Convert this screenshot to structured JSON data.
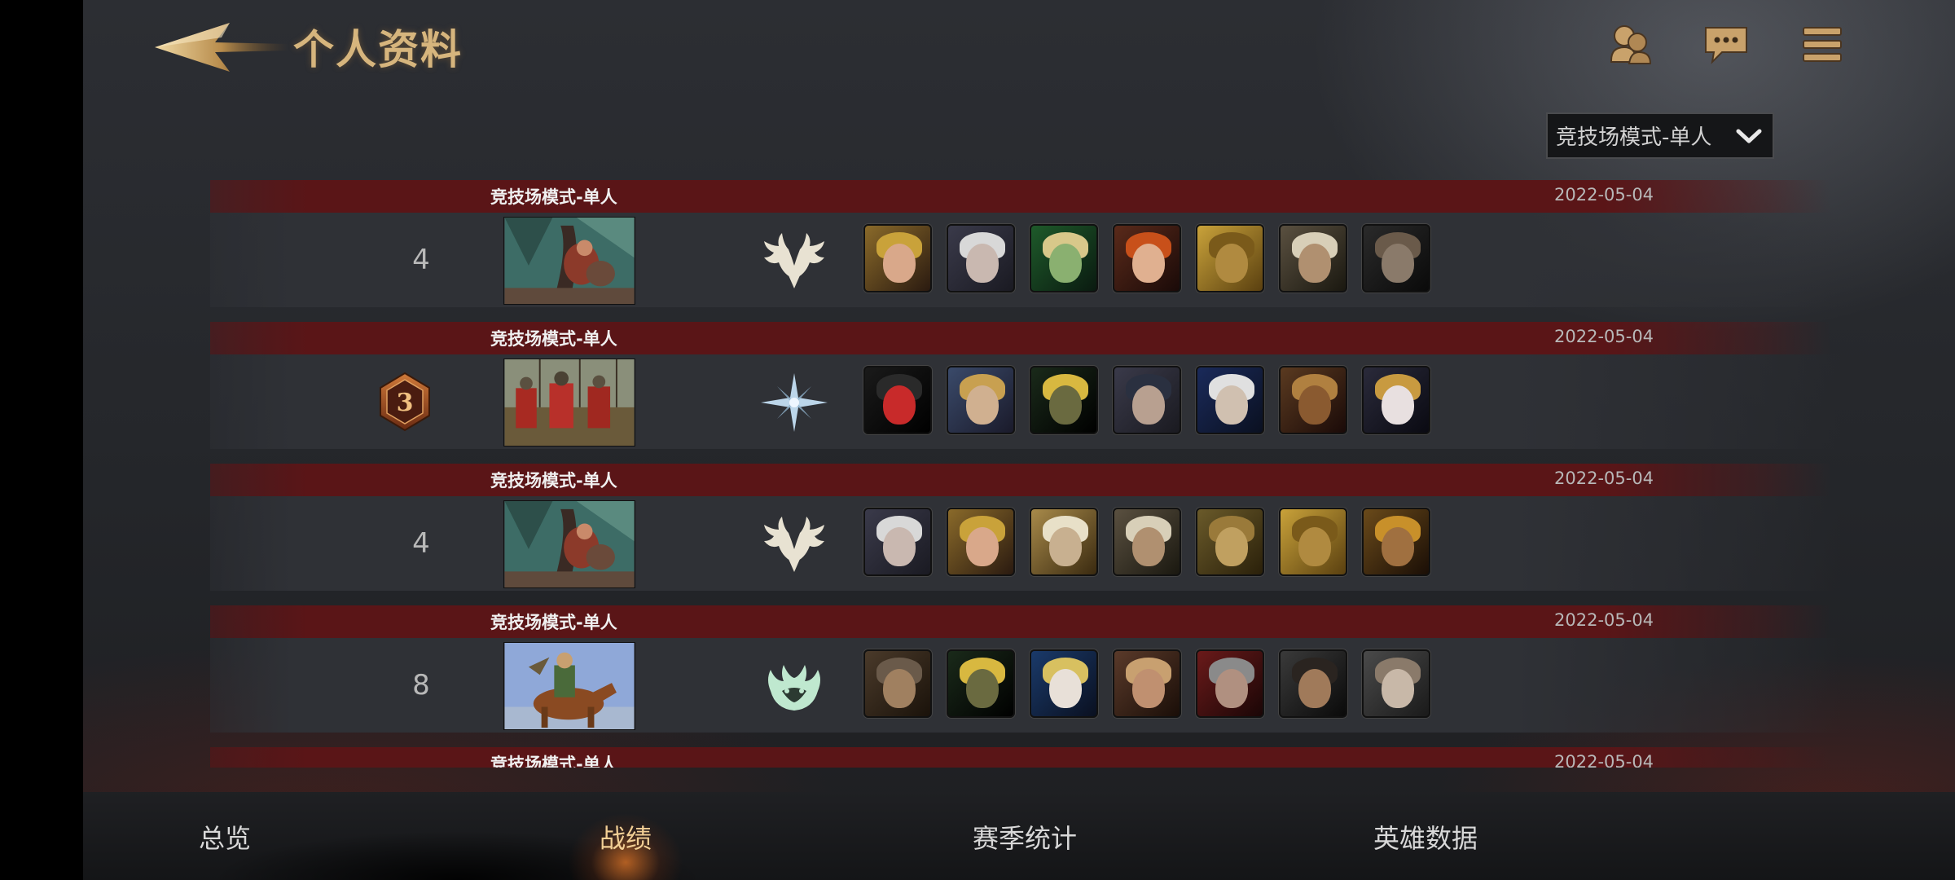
{
  "header": {
    "title": "个人资料"
  },
  "filter": {
    "selected": "竞技场模式-单人"
  },
  "matches": [
    {
      "mode": "竞技场模式-单人",
      "date": "2022-05-04",
      "rank": "4"
    },
    {
      "mode": "竞技场模式-单人",
      "date": "2022-05-04",
      "rank": "3"
    },
    {
      "mode": "竞技场模式-单人",
      "date": "2022-05-04",
      "rank": "4"
    },
    {
      "mode": "竞技场模式-单人",
      "date": "2022-05-04",
      "rank": "8"
    },
    {
      "mode": "竞技场模式-单人",
      "date": "2022-05-04",
      "rank": ""
    }
  ],
  "tabs": [
    {
      "label": "总览"
    },
    {
      "label": "战绩"
    },
    {
      "label": "赛季统计"
    },
    {
      "label": "英雄数据"
    }
  ],
  "colors": {
    "accent_gold": "#d6b57d",
    "row_header": "#5a1517",
    "active_tab": "#f2cf95"
  }
}
